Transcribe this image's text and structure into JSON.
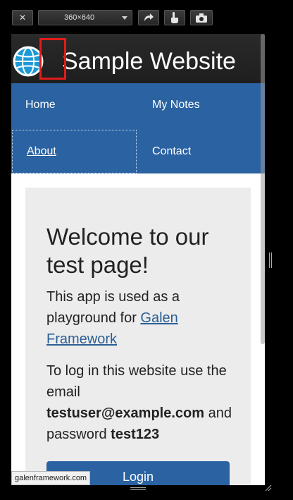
{
  "toolbar": {
    "close_label": "✕",
    "device_size": "360×640",
    "icons": [
      "close-icon",
      "chevron-down-icon",
      "rotate-icon",
      "touch-icon",
      "camera-icon"
    ]
  },
  "site": {
    "title": "Sample Website",
    "logo_icon": "globe-icon",
    "nav": [
      "Home",
      "My Notes",
      "About",
      "Contact"
    ],
    "active_nav": "About"
  },
  "welcome": {
    "title": "Welcome to our test page!",
    "intro_text": "This app is used as a playground for ",
    "intro_link": "Galen Framework",
    "login_prefix": "To log in this website use the email ",
    "email": "testuser@example.com",
    "password_prefix": " and password ",
    "password": "test123",
    "login_button": "Login"
  },
  "status_bar": {
    "url": "galenframework.com"
  },
  "colors": {
    "header_bg": "#222222",
    "nav_bg": "#2b62a1",
    "panel_bg": "#ececec",
    "link": "#2b5f96",
    "highlight": "#e21b1b"
  }
}
